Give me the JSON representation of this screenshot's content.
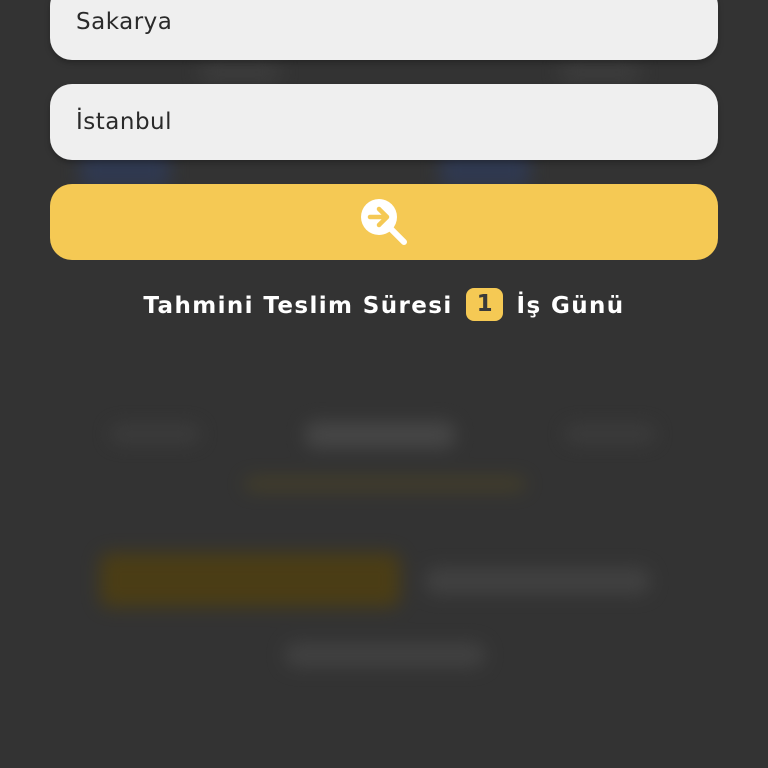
{
  "route": {
    "from_value": "Sakarya",
    "to_value": "İstanbul"
  },
  "search_button": {
    "icon": "search-arrow-icon",
    "color": "#f5c954"
  },
  "delivery_estimate": {
    "prefix": "Tahmini Teslim Süresi",
    "days": "1",
    "suffix": "İş Günü"
  },
  "colors": {
    "background": "#333333",
    "accent": "#f5c954",
    "field": "#efefef"
  }
}
